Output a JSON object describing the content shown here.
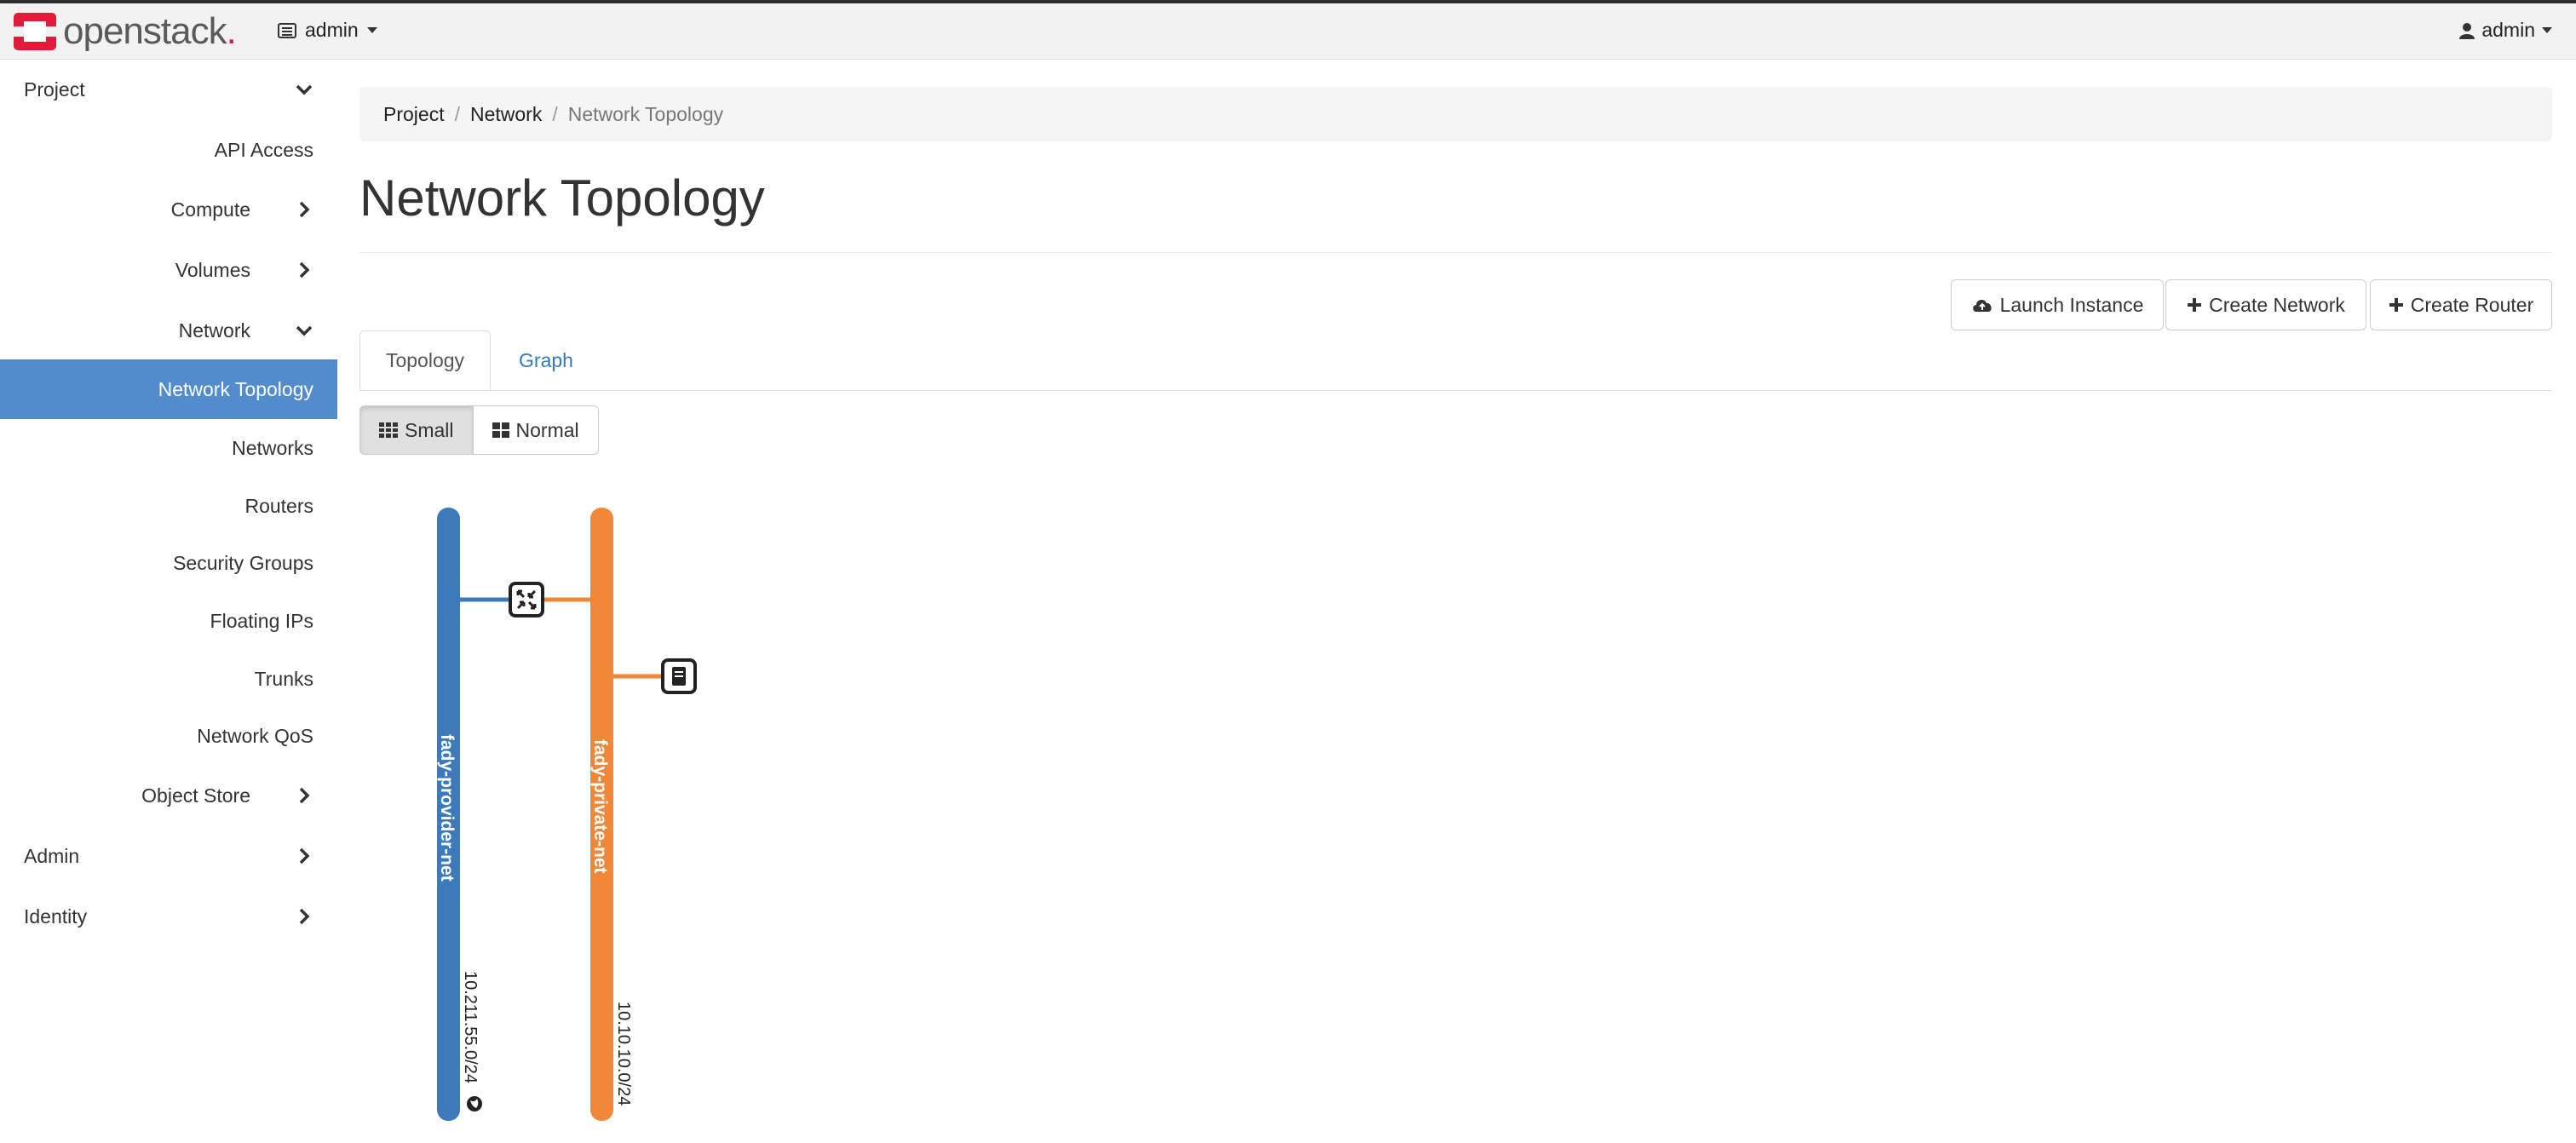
{
  "brand": {
    "name": "openstack",
    "dot": "."
  },
  "header": {
    "project": "admin",
    "user": "admin"
  },
  "sidebar": {
    "project": "Project",
    "api_access": "API Access",
    "compute": "Compute",
    "volumes": "Volumes",
    "network": "Network",
    "network_items": [
      "Network Topology",
      "Networks",
      "Routers",
      "Security Groups",
      "Floating IPs",
      "Trunks",
      "Network QoS"
    ],
    "object_store": "Object Store",
    "admin": "Admin",
    "identity": "Identity"
  },
  "breadcrumb": {
    "items": [
      "Project",
      "Network"
    ],
    "current": "Network Topology",
    "separator": "/"
  },
  "page": {
    "title": "Network Topology"
  },
  "actions": {
    "launch_instance": "Launch Instance",
    "create_network": "Create Network",
    "create_router": "Create Router"
  },
  "tabs": {
    "topology": "Topology",
    "graph": "Graph"
  },
  "view_toggle": {
    "small": "Small",
    "normal": "Normal",
    "selected": "Small"
  },
  "topology": {
    "networks": [
      {
        "name": "fady-provider-net",
        "cidr": "10.211.55.0/24",
        "color": "#3c7abb",
        "external": true
      },
      {
        "name": "fady-private-net",
        "cidr": "10.10.10.0/24",
        "color": "#f0883a",
        "external": false
      }
    ],
    "router_icon": "router-icon",
    "instance_icon": "instance-icon"
  },
  "colors": {
    "accent": "#538ccd",
    "link": "#337ab7",
    "brand_red": "#e31b3b"
  }
}
